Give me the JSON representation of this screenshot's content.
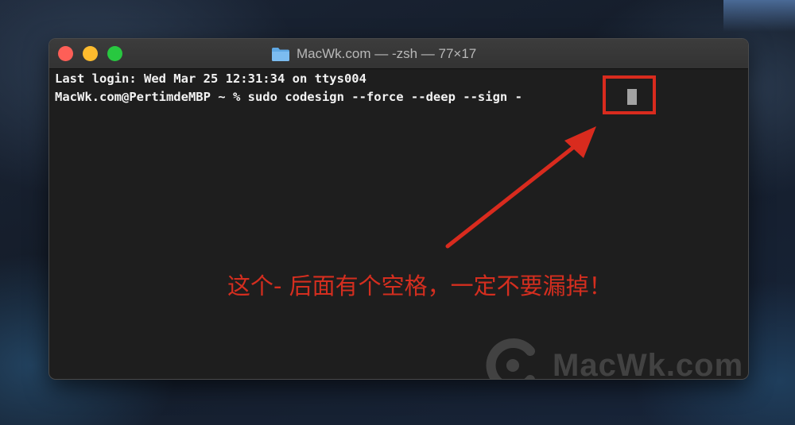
{
  "window": {
    "title": "MacWk.com — -zsh — 77×17",
    "folder_icon": "folder-icon"
  },
  "terminal": {
    "lines": [
      "Last login: Wed Mar 25 12:31:34 on ttys004",
      "MacWk.com@PertimdeMBP ~ % sudo codesign --force --deep --sign -"
    ]
  },
  "annotation": {
    "text": "这个- 后面有个空格，一定不要漏掉！",
    "color": "#d42e1f"
  },
  "watermark": {
    "text": "MacWk.com"
  },
  "colors": {
    "terminal_bg": "#1e1e1e",
    "terminal_text": "#f2f2f2",
    "close": "#fe5f57",
    "minimize": "#febc2e",
    "zoom": "#28c840",
    "annotation_red": "#d92b1e"
  }
}
